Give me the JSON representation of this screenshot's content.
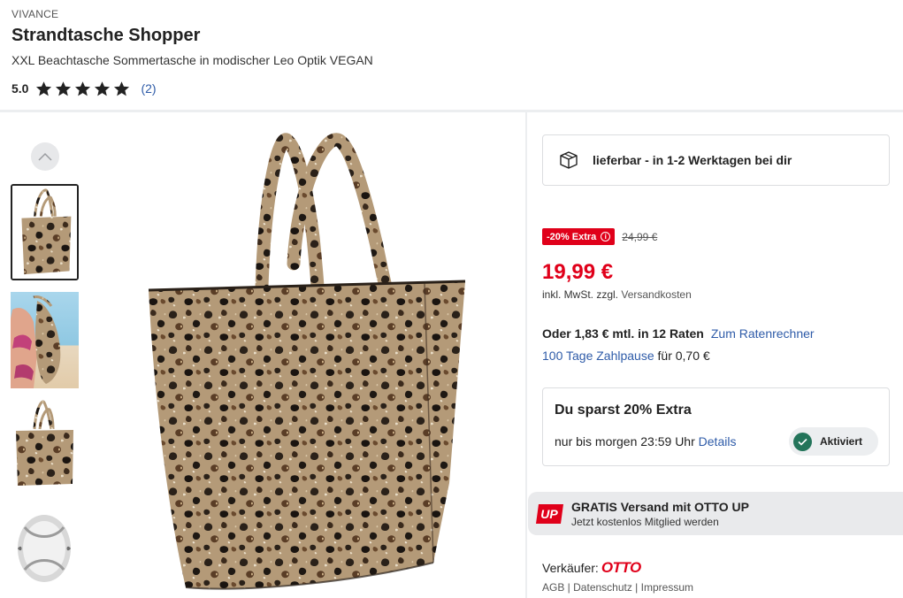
{
  "product": {
    "brand": "VIVANCE",
    "title": "Strandtasche Shopper",
    "subtitle": "XXL Beachtasche Sommertasche in modischer Leo Optik VEGAN",
    "rating_score": "5.0",
    "rating_stars": 5,
    "rating_count": "(2)"
  },
  "gallery": {
    "up_icon": "chevron-up-icon",
    "thumbnails": [
      "leopard-tote-bag",
      "model-beach-bikini",
      "leopard-tote-bag-small",
      "bag-interior-open"
    ],
    "active_index": 0
  },
  "delivery": {
    "icon": "box-icon",
    "text": "lieferbar - in 1-2 Werktagen bei dir"
  },
  "pricing": {
    "discount_badge": "-20% Extra",
    "info_symbol": "i",
    "old_price": "24,99 €",
    "price": "19,99 €",
    "tax_prefix": "inkl. MwSt. zzgl.",
    "tax_link": "Versandkosten",
    "installment_text": "Oder 1,83 € mtl. in 12 Raten",
    "installment_link": "Zum Ratenrechner",
    "paypause_link": "100 Tage Zahlpause",
    "paypause_suffix": "für 0,70 €"
  },
  "savings": {
    "title": "Du sparst 20% Extra",
    "deadline": "nur bis morgen 23:59 Uhr",
    "details_link": "Details",
    "status_label": "Aktiviert"
  },
  "otto_up": {
    "logo_text": "UP",
    "headline": "GRATIS Versand mit OTTO UP",
    "subline": "Jetzt kostenlos Mitglied werden"
  },
  "seller": {
    "label": "Verkäufer:",
    "name": "OTTO",
    "links": [
      "AGB",
      "Datenschutz",
      "Impressum"
    ],
    "separator": " | "
  },
  "colors": {
    "accent_red": "#e0001a",
    "link_blue": "#2e5ba8",
    "success_green": "#23745a"
  }
}
